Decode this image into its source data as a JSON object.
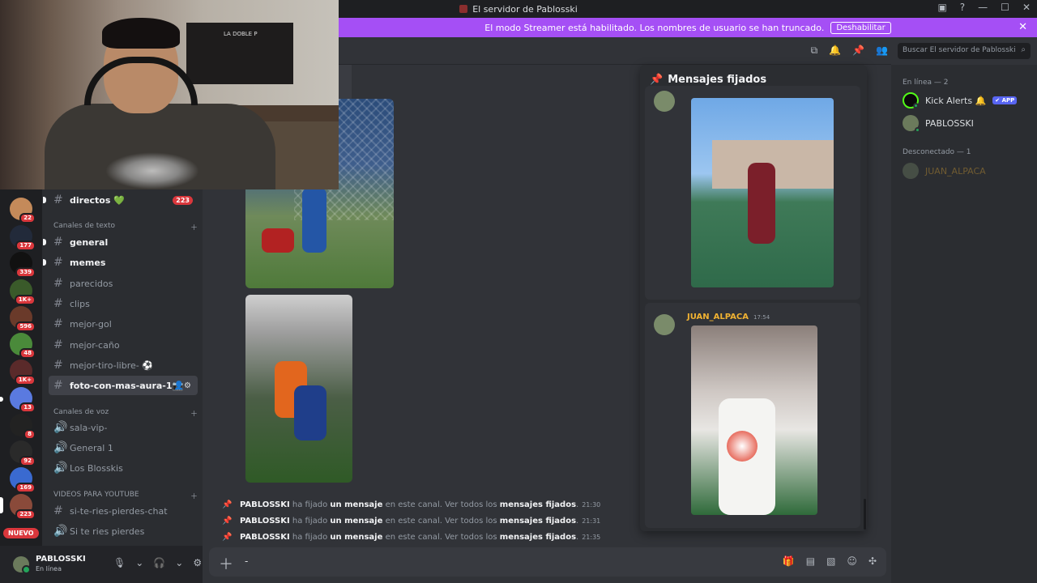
{
  "titlebar": {
    "title": "El servidor de Pablosski"
  },
  "banner": {
    "text": "El modo Streamer está habilitado. Los nombres de usuario se han truncado.",
    "button": "Deshabilitar"
  },
  "search": {
    "placeholder": "Buscar El servidor de Pablosski"
  },
  "servers": [
    {
      "badge": "22",
      "color": "#c48a5a"
    },
    {
      "badge": "177",
      "color": "#222a3a"
    },
    {
      "badge": "339",
      "color": "#111111"
    },
    {
      "badge": "1K+",
      "color": "#3a5a2a"
    },
    {
      "badge": "596",
      "color": "#6a3a2a"
    },
    {
      "badge": "48",
      "color": "#4a8a3a"
    },
    {
      "badge": "1K+",
      "color": "#5a2a2a"
    },
    {
      "badge": "13",
      "color": "#5a7ae0"
    },
    {
      "badge": "8",
      "color": "#222222"
    },
    {
      "badge": "92",
      "color": "#2a2a2a"
    },
    {
      "badge": "169",
      "color": "#3a6ad0"
    },
    {
      "badge": "223",
      "color": "#8a4a3a"
    }
  ],
  "nuevo": "NUEVO",
  "channels": {
    "top": {
      "name": "directos 💚",
      "mention": "223"
    },
    "text_category": "Canales de texto",
    "text": [
      "general",
      "memes",
      "parecidos",
      "clips",
      "mejor-gol",
      "mejor-caño",
      "mejor-tiro-libre- ⚽",
      "foto-con-mas-aura-1📷"
    ],
    "voice_category": "Canales de voz",
    "voice": [
      "sala-vip-",
      "General 1",
      "Los Blosskis"
    ],
    "yt_category": "VIDEOS PARA YOUTUBE",
    "yt": [
      "si-te-ries-pierdes-chat",
      "Si te ries pierdes"
    ]
  },
  "user": {
    "name": "PABLOSSKI",
    "status": "En línea"
  },
  "system_messages": [
    {
      "user": "PABLOSSKI",
      "a": "ha fijado",
      "b": "un mensaje",
      "c": "en este canal. Ver todos los",
      "d": "mensajes fijados",
      "time": "21:30"
    },
    {
      "user": "PABLOSSKI",
      "a": "ha fijado",
      "b": "un mensaje",
      "c": "en este canal. Ver todos los",
      "d": "mensajes fijados",
      "time": "21:31"
    },
    {
      "user": "PABLOSSKI",
      "a": "ha fijado",
      "b": "un mensaje",
      "c": "en este canal. Ver todos los",
      "d": "mensajes fijados",
      "time": "21:35"
    }
  ],
  "composer": {
    "value": "-"
  },
  "pinned": {
    "title": "Mensajes fijados",
    "second": {
      "author": "JUAN_ALPACA",
      "time": "17:54"
    }
  },
  "members": {
    "online_header": "En línea — 2",
    "online": [
      {
        "name": "Kick Alerts 🔔",
        "badge": "✔ APP"
      },
      {
        "name": "PABLOSSKI"
      }
    ],
    "offline_header": "Desconectado — 1",
    "offline": [
      {
        "name": "JUAN_ALPACA"
      }
    ]
  }
}
